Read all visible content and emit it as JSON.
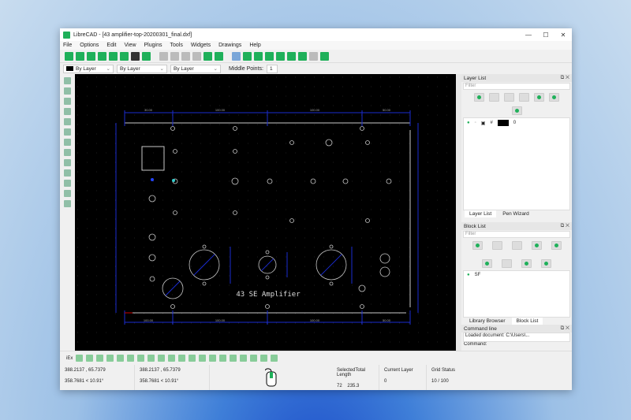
{
  "window": {
    "title": "LibreCAD - [43 amplifier-top-20200301_final.dxf]",
    "minimize": "—",
    "maximize": "☐",
    "close": "✕"
  },
  "menu": [
    "File",
    "Options",
    "Edit",
    "View",
    "Plugins",
    "Tools",
    "Widgets",
    "Drawings",
    "Help"
  ],
  "pen_toolbar": {
    "color": "By Layer",
    "width": "By Layer",
    "linetype": "By Layer",
    "middle_points_label": "Middle Points:",
    "middle_points_value": "1"
  },
  "drawing": {
    "title_text": "43 SE Amplifier",
    "dims_top": [
      "30.00",
      "100.00",
      "100.00",
      "50.00"
    ],
    "dims_bottom": [
      "100.00",
      "100.00",
      "100.00",
      "50.00"
    ],
    "colors": {
      "background": "#000000",
      "geometry": "#c8c8c8",
      "dimension": "#1a2bd0"
    }
  },
  "layer_list": {
    "title": "Layer List",
    "filter_placeholder": "Filter",
    "layers": [
      {
        "name": "0",
        "color": "#000000"
      }
    ],
    "tabs": [
      "Layer List",
      "Pen Wizard"
    ]
  },
  "block_list": {
    "title": "Block List",
    "filter_placeholder": "Filter",
    "blocks": [
      "SF"
    ],
    "tabs": [
      "Library Browser",
      "Block List"
    ]
  },
  "command_line": {
    "title": "Command line",
    "output": "Loaded document: C:\\Users\\...",
    "prompt": "Command:"
  },
  "status": {
    "abs_coords": "388.2137 , 65.7379",
    "polar_coords": "358.7681 < 10.91°",
    "rel_coords": "388.2137 , 65.7379",
    "rel_polar": "358.7681 < 10.91°",
    "selected_label": "Selected",
    "selected_value": "72",
    "total_length_label": "Total Length",
    "total_length_value": "235.3",
    "current_layer_label": "Current Layer",
    "current_layer_value": "0",
    "grid_status_label": "Grid Status",
    "grid_status_value": "10 / 100"
  },
  "snap_toolbar": {
    "exclusive_label": "iEx"
  }
}
